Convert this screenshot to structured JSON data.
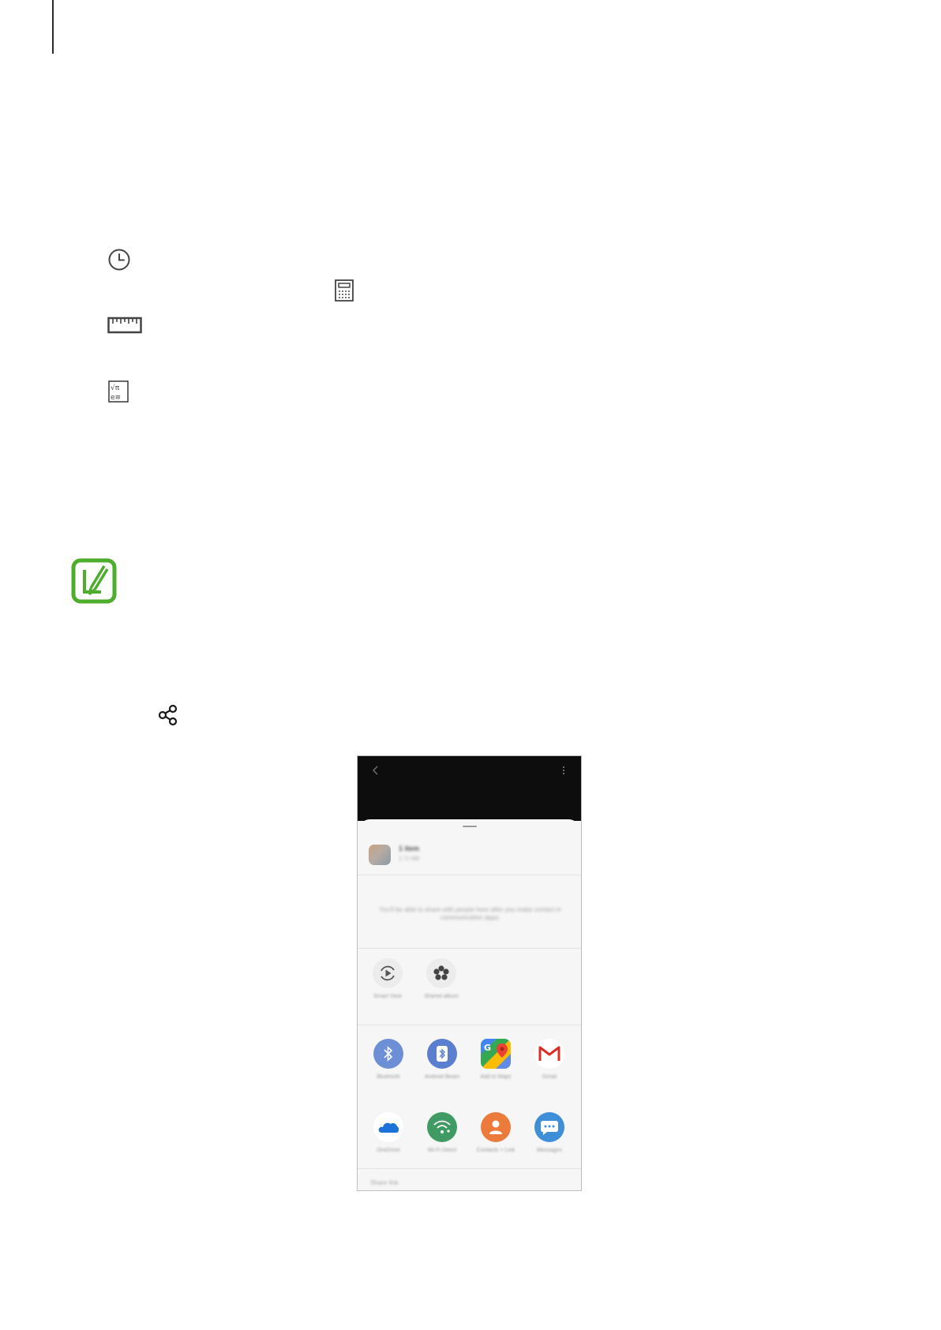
{
  "page": {
    "rule": "vertical-rule"
  },
  "inline_icons": [
    "history-clock-icon",
    "calculator-icon",
    "ruler-icon",
    "scientific-calculator-icon",
    "note-pencil-icon",
    "share-icon"
  ],
  "phone": {
    "top_bar": {
      "back_icon": "chevron-left-icon",
      "more_icon": "more-vertical-icon"
    },
    "sheet": {
      "title": "1 item",
      "subtitle": "2.71 MB",
      "message": "You'll be able to share with people here after you make contact in communication apps.",
      "quick_share": [
        {
          "label": "Smart View",
          "icon": "smart-view-icon"
        },
        {
          "label": "Shared album",
          "icon": "shared-album-icon"
        }
      ],
      "apps_row1": [
        {
          "label": "Bluetooth",
          "icon": "bluetooth-icon",
          "color": "#6d8fd6"
        },
        {
          "label": "Android Beam",
          "icon": "android-beam-icon",
          "color": "#5b7fd0"
        },
        {
          "label": "Add to Maps",
          "icon": "google-maps-icon",
          "color": "#34a853"
        },
        {
          "label": "Gmail",
          "icon": "gmail-icon",
          "color": "#ffffff"
        }
      ],
      "apps_row2": [
        {
          "label": "OneDrive",
          "icon": "onedrive-icon",
          "color": "#ffffff"
        },
        {
          "label": "Wi-Fi Direct",
          "icon": "wifi-direct-icon",
          "color": "#3f9a63"
        },
        {
          "label": "Contacts + Link",
          "icon": "contacts-icon",
          "color": "#ec7b3b"
        },
        {
          "label": "Messages",
          "icon": "messages-icon",
          "color": "#3e8ed8"
        }
      ],
      "footer": "Share link"
    }
  }
}
